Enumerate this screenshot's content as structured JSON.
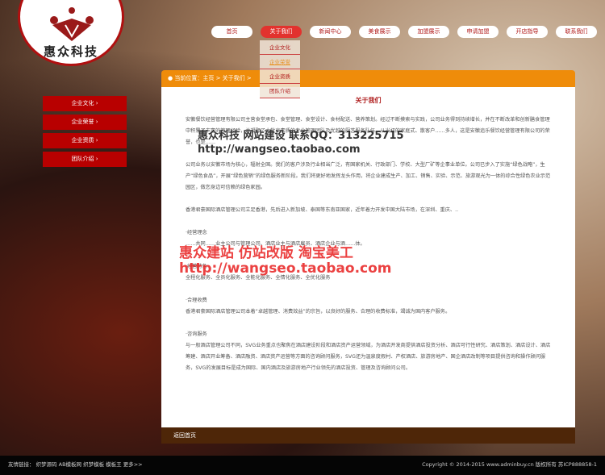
{
  "logo": {
    "name": "惠众科技"
  },
  "nav": [
    "首页",
    "关于我们",
    "新闻中心",
    "美食展示",
    "加盟展示",
    "申请加盟",
    "开店指导",
    "联系我们"
  ],
  "dropdown": [
    "企业文化",
    "企业荣誉",
    "企业资质",
    "团队介绍"
  ],
  "breadcrumb": "当前位置：主页 > 关于我们 >",
  "sidebar": [
    "企业文化 ›",
    "企业荣誉 ›",
    "企业资质 ›",
    "团队介绍 ›"
  ],
  "content": {
    "title": "关于我们",
    "p1": "安徽餐饮经营管理有限公司主营食堂承包、食堂管理、食堂设计、食材配送、营养策划。经过不断摸索与实践，公司业务得到持续增长，并在不断改革和创新膳食管理中积累了丰富的管理经验，并凝聚了大批高素质的专业管理团队及优越的厨艺服务队伍。从当初的家庭式、散客户……多人，这是安徽追乐餐饮经营管理有限公司的荣誉，也是……",
    "p2": "公司业务以安徽市场为核心，辐射全国。我们的客户涉及行业相当广泛，有国家机关、行政部门、学校、大型厂矿等企事业单位。公司已步入了实施“绿色战略”，生产“绿色食品”，开展“绿色营销”的绿色服务新阶段。我们将更好地发挥龙头作用，将企业建成生产、加工、销售、实验、示范、旅游观光为一体的综合性绿色农业示范园区，做您身边可信赖的绿色家园。",
    "p3": "香港君豪国际酒店管理公司立足香港，先后进入新加坡、泰国等东南亚国家，近年着力开发中国大陆市场，在深圳、重庆、..",
    "h4": "·经营理念",
    "p4": "……共同……业主公司与管理公司、酒店业主与酒店雇员、酒店企业与酒……体。",
    "h5": "·经营特色",
    "p5": "全程化服务、全员化服务、全能化服务、全情化服务、全优化服务",
    "h6": "·合理收费",
    "p6": "香港君豪国际酒店管理公司本着“卓越管理、消费效益”的宗旨，以良好的服务、合理的收费标准，竭诚为国内客户服务。",
    "h7": "·咨询服务",
    "p7": "与一般酒店管理公司不同，SVG业务重点也聚焦在酒店建设阶段和酒店资产运营领域，为酒店开发商提供酒店投资分析、酒店可行性研究、酒店策划、酒店设计、酒店筹建、酒店开业筹备、酒店融资、酒店资产运营等方面的咨询顾问服务，SVG还为温泉度假村、产权酒店、旅游房地产、国企酒店改制等项目提供咨询和操作顾问服务，SVG的发展目标是成为国际、国内酒店及旅游房地产行业领先的酒店投资、管理及咨询顾问公司。"
  },
  "watermark1": [
    "惠众科技 网站建设 联系QQ：313225715",
    "http://wangseo.taobao.com"
  ],
  "watermark2": [
    "惠众建站 仿站改版 淘宝美工",
    "http://wangseo.taobao.com"
  ],
  "back_label": "返回首页",
  "footer": {
    "links": "友情链接： 织梦源码 AB模板网 织梦模板 模板王  更多>>",
    "copyright": "Copyright © 2014-2015 www.adminbuy.cn 版权所有 苏ICP888858-1"
  }
}
